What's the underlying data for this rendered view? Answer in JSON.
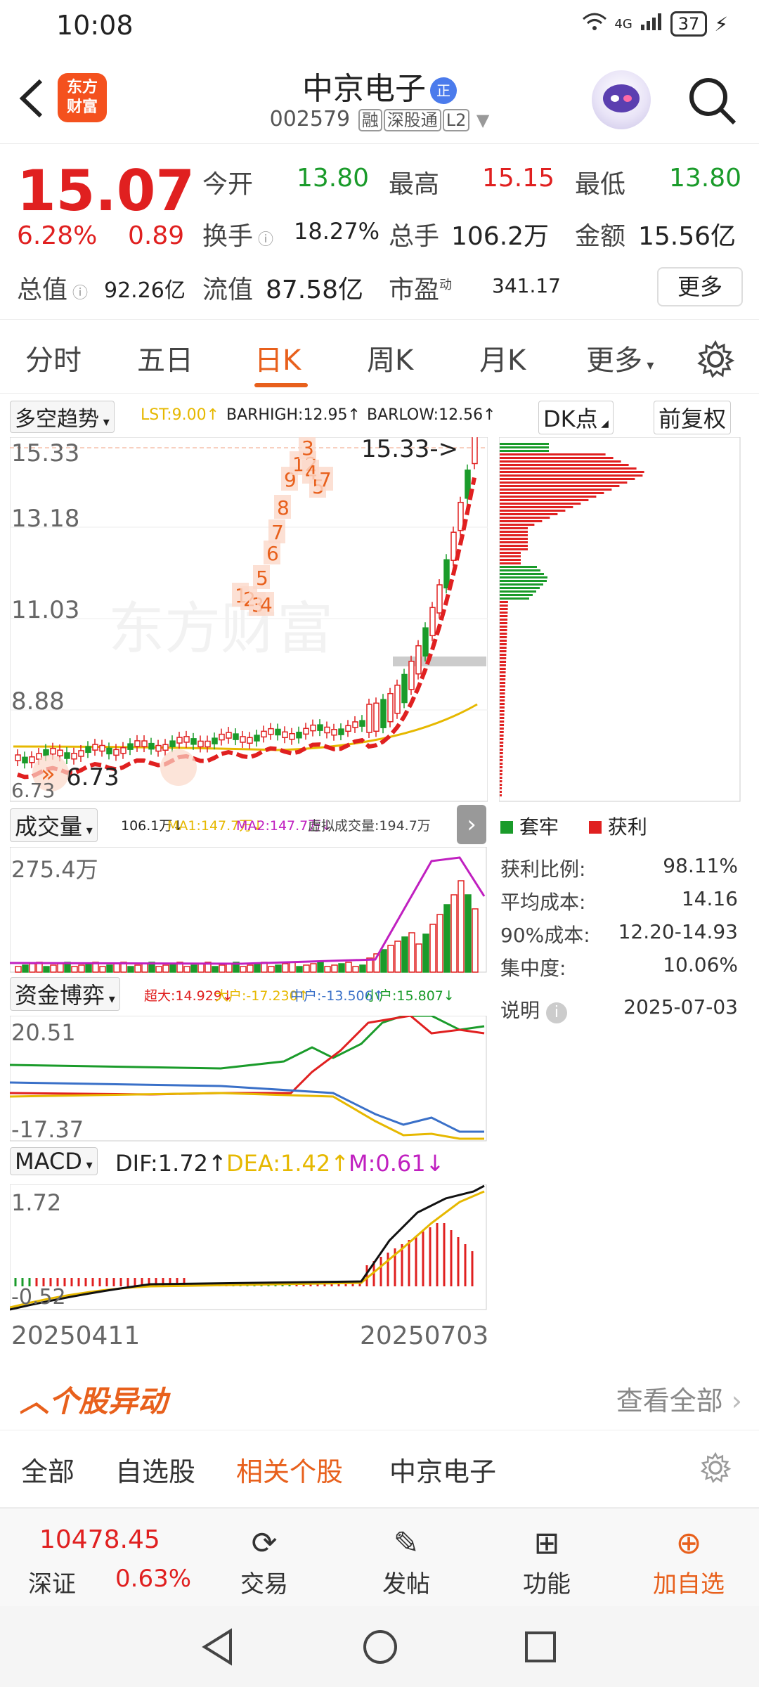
{
  "status": {
    "time": "10:08",
    "network": "4G",
    "battery": "37"
  },
  "header": {
    "logo_text": "东方财富",
    "name": "中京电子",
    "name_badge": "正",
    "code": "002579",
    "tags": [
      "融",
      "深股通",
      "L2"
    ]
  },
  "quote": {
    "price": "15.07",
    "change_pct": "6.28%",
    "change": "0.89",
    "open_label": "今开",
    "open": "13.80",
    "high_label": "最高",
    "high": "15.15",
    "low_label": "最低",
    "low": "13.80",
    "turnover_label": "换手",
    "turnover": "18.27%",
    "volume_label": "总手",
    "volume": "106.2万",
    "amount_label": "金额",
    "amount": "15.56亿",
    "mktcap_label": "总值",
    "mktcap": "92.26亿",
    "float_label": "流值",
    "float": "87.58亿",
    "pe_label": "市盈",
    "pe_sup": "动",
    "pe": "341.17",
    "more_label": "更多"
  },
  "tabs": {
    "items": [
      "分时",
      "五日",
      "日K",
      "周K",
      "月K",
      "更多"
    ],
    "active": "日K"
  },
  "kline": {
    "indicator_name": "多空趋势",
    "lst": "LST:9.00↑",
    "barhigh": "BARHIGH:12.95↑",
    "barlow": "BARLOW:12.56↑",
    "dk_label": "DK点",
    "adjust_label": "前复权",
    "y_labels": [
      "15.33",
      "13.18",
      "11.03",
      "8.88",
      "6.73"
    ],
    "max_marker": "15.33->",
    "min_marker": "6.73",
    "watermark": "东方财富",
    "seq_labels": [
      "1",
      "2",
      "3",
      "4",
      "5",
      "6",
      "7",
      "8",
      "9",
      "12",
      "3",
      "4",
      "5",
      "7"
    ]
  },
  "volume": {
    "title": "成交量",
    "vol": "106.1万↓",
    "ma1": "MA1:147.7万↓",
    "ma2": "MA2:147.7万↓",
    "virtual": "虚拟成交量:194.7万",
    "y_label": "275.4万"
  },
  "funds": {
    "title": "资金博弈",
    "super": "超大:14.929↓",
    "large": "大户:-17.230↑",
    "medium": "中户:-13.506↑",
    "small": "小户:15.807↓",
    "y_top": "20.51",
    "y_bottom": "-17.37"
  },
  "macd": {
    "title": "MACD",
    "dif": "DIF:1.72↑",
    "dea": "DEA:1.42↑",
    "m": "M:0.61↓",
    "y_top": "1.72",
    "y_bottom": "-0.52",
    "date_start": "20250411",
    "date_end": "20250703"
  },
  "chip": {
    "legend_trapped": "套牢",
    "legend_profit": "获利",
    "rows": [
      {
        "label": "获利比例:",
        "value": "98.11%"
      },
      {
        "label": "平均成本:",
        "value": "14.16"
      },
      {
        "label": "90%成本:",
        "value": "12.20-14.93"
      },
      {
        "label": "集中度:",
        "value": "10.06%"
      }
    ],
    "note_label": "说明",
    "date": "2025-07-03"
  },
  "movers": {
    "title": "个股异动",
    "view_all": "查看全部"
  },
  "subtabs": {
    "items": [
      "全部",
      "自选股",
      "相关个股",
      "中京电子"
    ],
    "active": "相关个股"
  },
  "bottomnav": {
    "index_value": "10478.45",
    "index_name": "深证",
    "index_change": "0.63%",
    "items": [
      "交易",
      "发帖",
      "功能",
      "加自选"
    ]
  },
  "colors": {
    "up": "#e02020",
    "down": "#1a9b2a",
    "accent": "#e8601c"
  }
}
